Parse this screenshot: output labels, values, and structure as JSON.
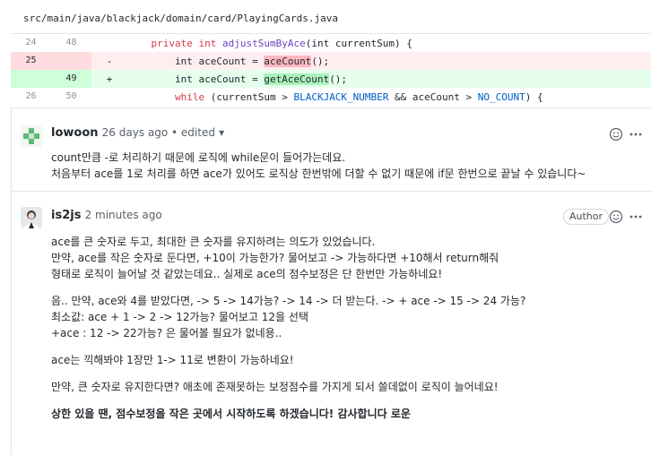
{
  "file": {
    "path": "src/main/java/blackjack/domain/card/PlayingCards.java"
  },
  "diff": [
    {
      "old": "24",
      "new": "48",
      "marker": "",
      "type": "ctx"
    },
    {
      "old": "25",
      "new": "",
      "marker": "-",
      "type": "del"
    },
    {
      "old": "",
      "new": "49",
      "marker": "+",
      "type": "add"
    },
    {
      "old": "26",
      "new": "50",
      "marker": "",
      "type": "ctx"
    }
  ],
  "code": {
    "l1_kw1": "private",
    "l1_kw2": "int",
    "l1_fn": "adjustSumByAce",
    "l1_rest": "(int currentSum) {",
    "l2_pre": "        int aceCount = ",
    "l2_hl": "aceCount",
    "l2_post": "();",
    "l3_pre": "        int aceCount = ",
    "l3_hl": "getAceCount",
    "l3_post": "();",
    "l4_kw": "while",
    "l4_a": " (currentSum > ",
    "l4_c1": "BLACKJACK_NUMBER",
    "l4_b": " && aceCount > ",
    "l4_c2": "NO_COUNT",
    "l4_end": ") {"
  },
  "comments": [
    {
      "author": "lowoon",
      "meta": "26 days ago • edited",
      "lines": [
        "count만큼 -로 처리하기 때문에 로직에 while문이 들어가는데요.",
        "처음부터 ace를 1로 처리를 하면 ace가 있어도 로직상 한번밖에 더할 수 없기 때문에 if문 한번으로 끝날 수 있습니다~"
      ]
    },
    {
      "author": "is2js",
      "meta": "2 minutes ago",
      "badge": "Author",
      "p1": [
        "ace를 큰 숫자로 두고, 최대한 큰 숫자를 유지하려는 의도가 있었습니다.",
        "만약, ace를 작은 숫자로 둔다면, +10이 가능한가? 물어보고 -> 가능하다면 +10해서 return해줘",
        "형태로 로직이 늘어날 것 같았는데요.. 실제로 ace의 점수보정은 단 한번만 가능하네요!"
      ],
      "p2": [
        "음.. 만약, ace와 4를 받았다면, -> 5 -> 14가능? -> 14 -> 더 받는다. -> + ace -> 15 -> 24 가능?",
        "최소값: ace + 1 -> 2 -> 12가능? 물어보고 12을 선택",
        "+ace : 12 -> 22가능? 은 물어볼 필요가 없네용.."
      ],
      "p3": "ace는 끽해봐야 1장만 1-> 11로 변환이 가능하네요!",
      "p4": "만약, 큰 숫자로 유지한다면? 애초에 존재못하는 보정점수를 가지게 되서 쓸데없이 로직이 늘어네요!",
      "p5": "상한 있을 땐, 점수보정을 작은 곳에서 시작하도록 하겠습니다! 감사합니다 로운"
    }
  ],
  "icons": {
    "emoji": "smiley-icon",
    "more": "kebab-icon",
    "caret": "caret-down-icon"
  }
}
